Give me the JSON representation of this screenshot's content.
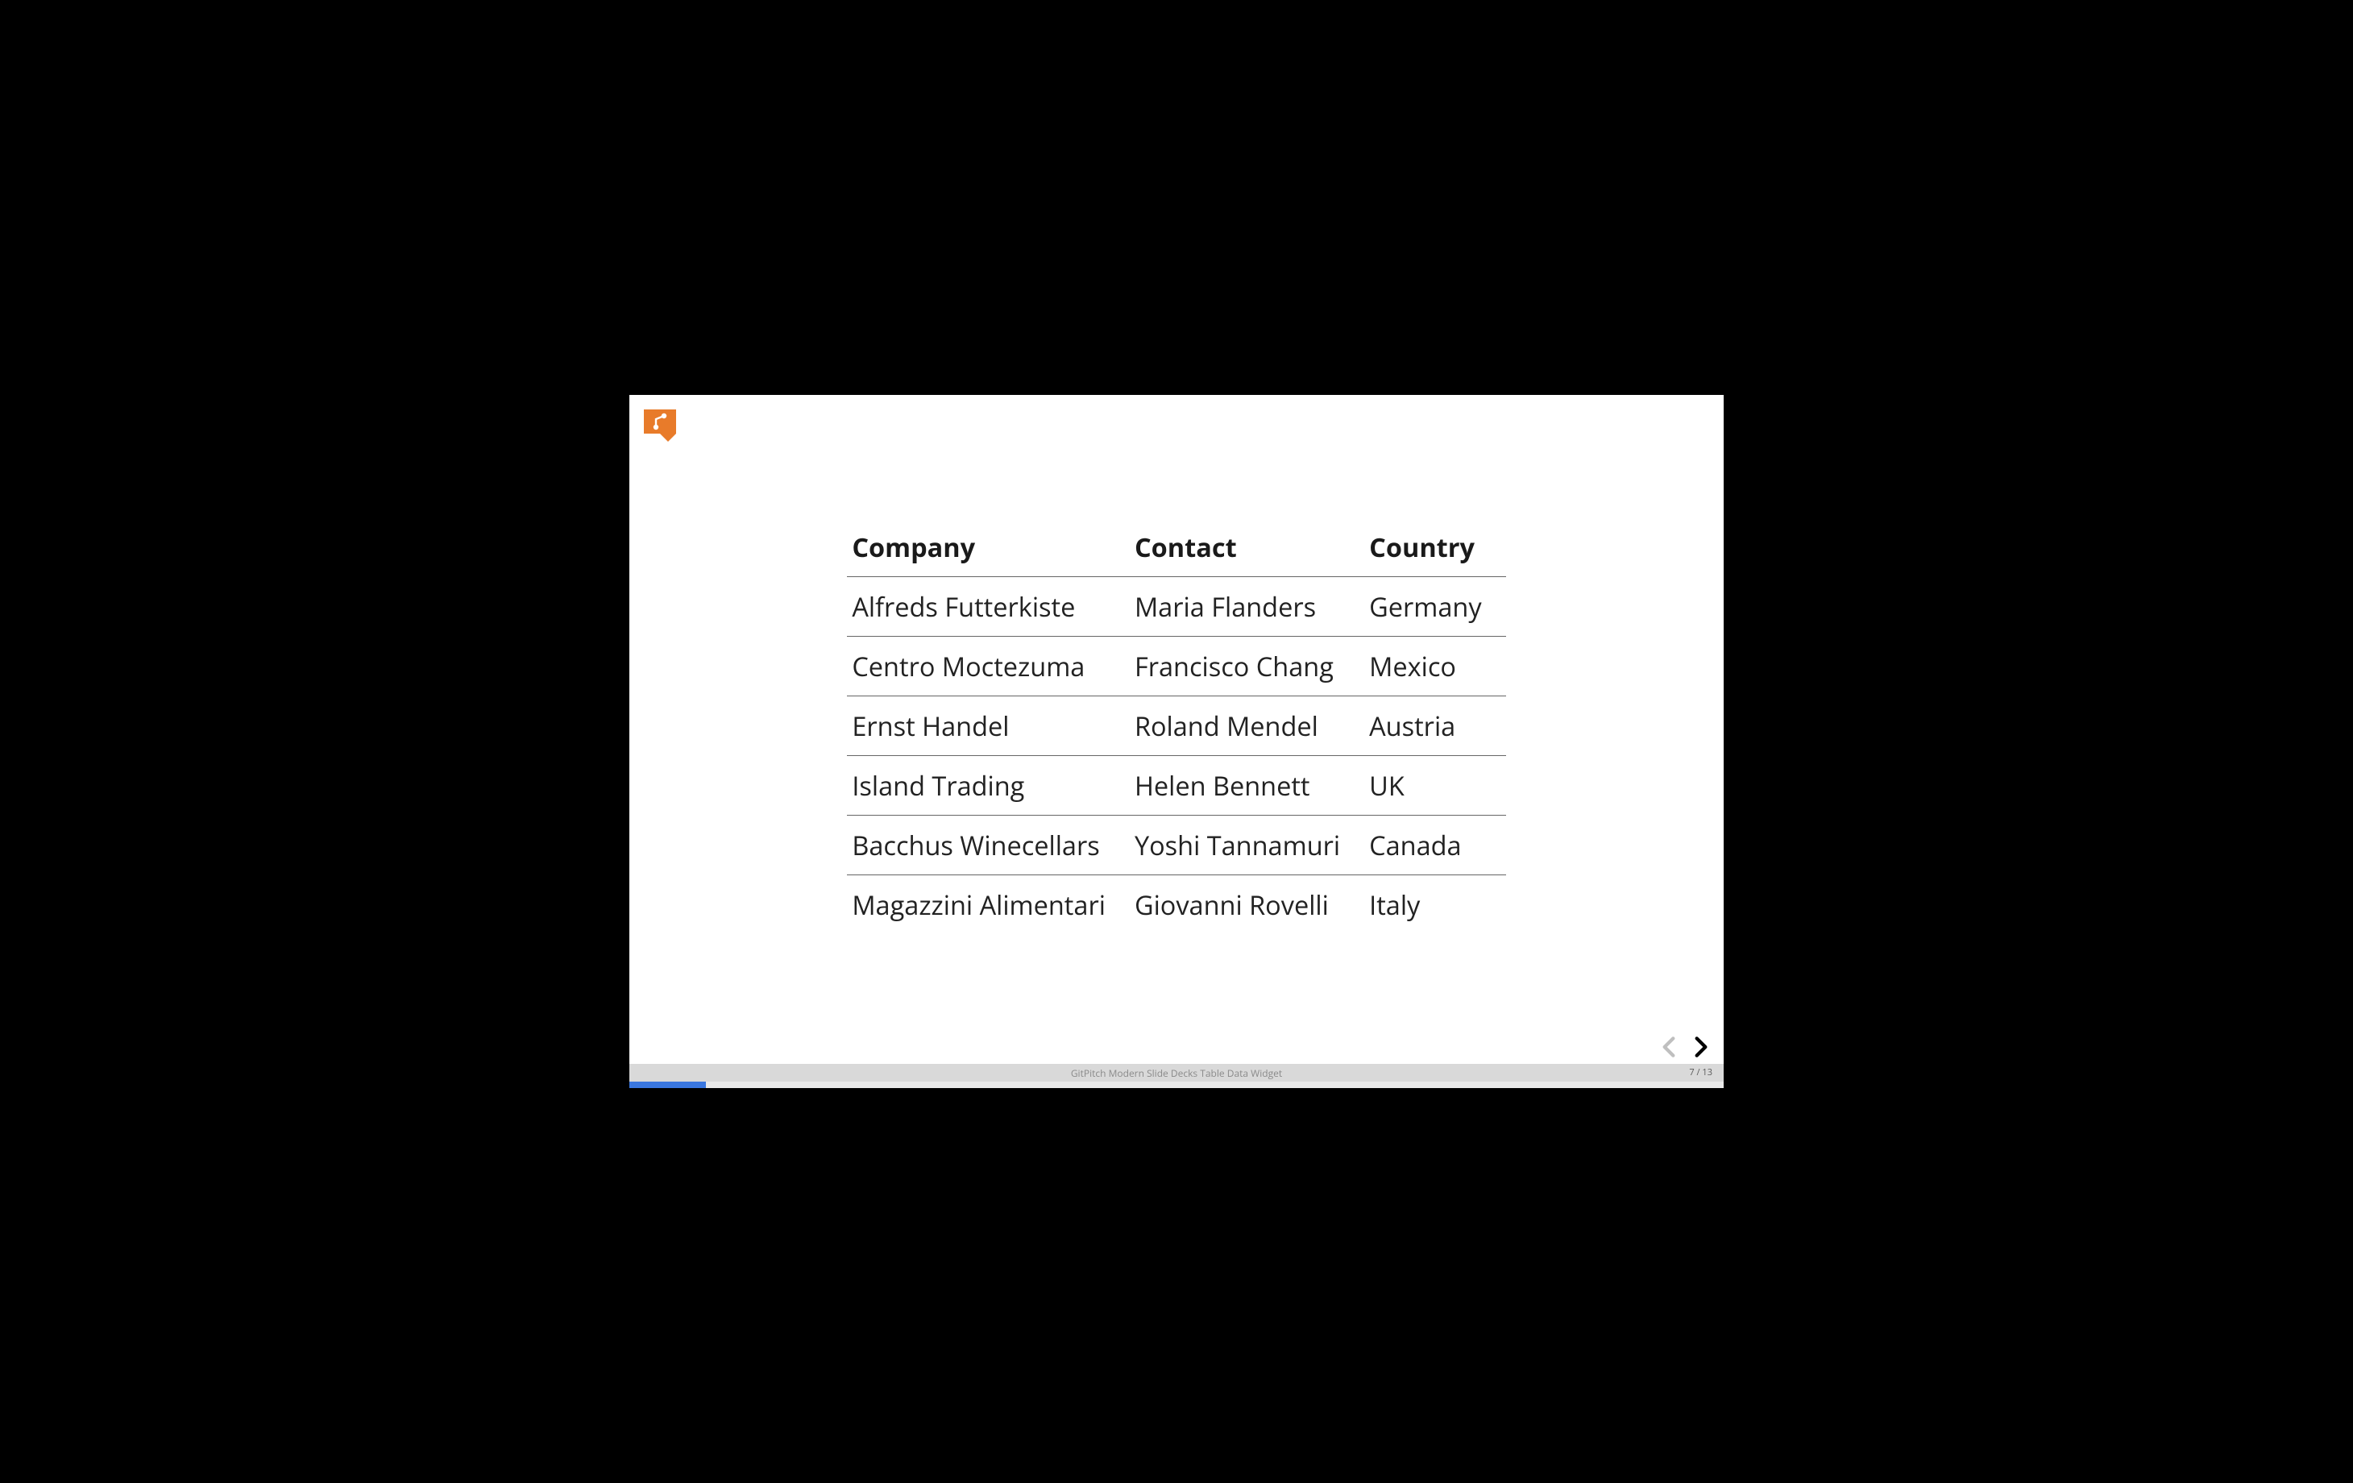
{
  "brand": {
    "icon_name": "gitpitch-logo"
  },
  "chart_data": {
    "type": "table",
    "headers": [
      "Company",
      "Contact",
      "Country"
    ],
    "rows": [
      [
        "Alfreds Futterkiste",
        "Maria Flanders",
        "Germany"
      ],
      [
        "Centro Moctezuma",
        "Francisco Chang",
        "Mexico"
      ],
      [
        "Ernst Handel",
        "Roland Mendel",
        "Austria"
      ],
      [
        "Island Trading",
        "Helen Bennett",
        "UK"
      ],
      [
        "Bacchus Winecellars",
        "Yoshi Tannamuri",
        "Canada"
      ],
      [
        "Magazzini Alimentari",
        "Giovanni Rovelli",
        "Italy"
      ]
    ]
  },
  "footer": {
    "caption": "GitPitch Modern Slide Decks Table Data Widget"
  },
  "pager": {
    "current": 7,
    "total": 13,
    "display": "7 / 13"
  },
  "progress": {
    "percent": 7
  },
  "colors": {
    "brand_orange": "#e87b2a",
    "progress_blue": "#3a77e0"
  }
}
